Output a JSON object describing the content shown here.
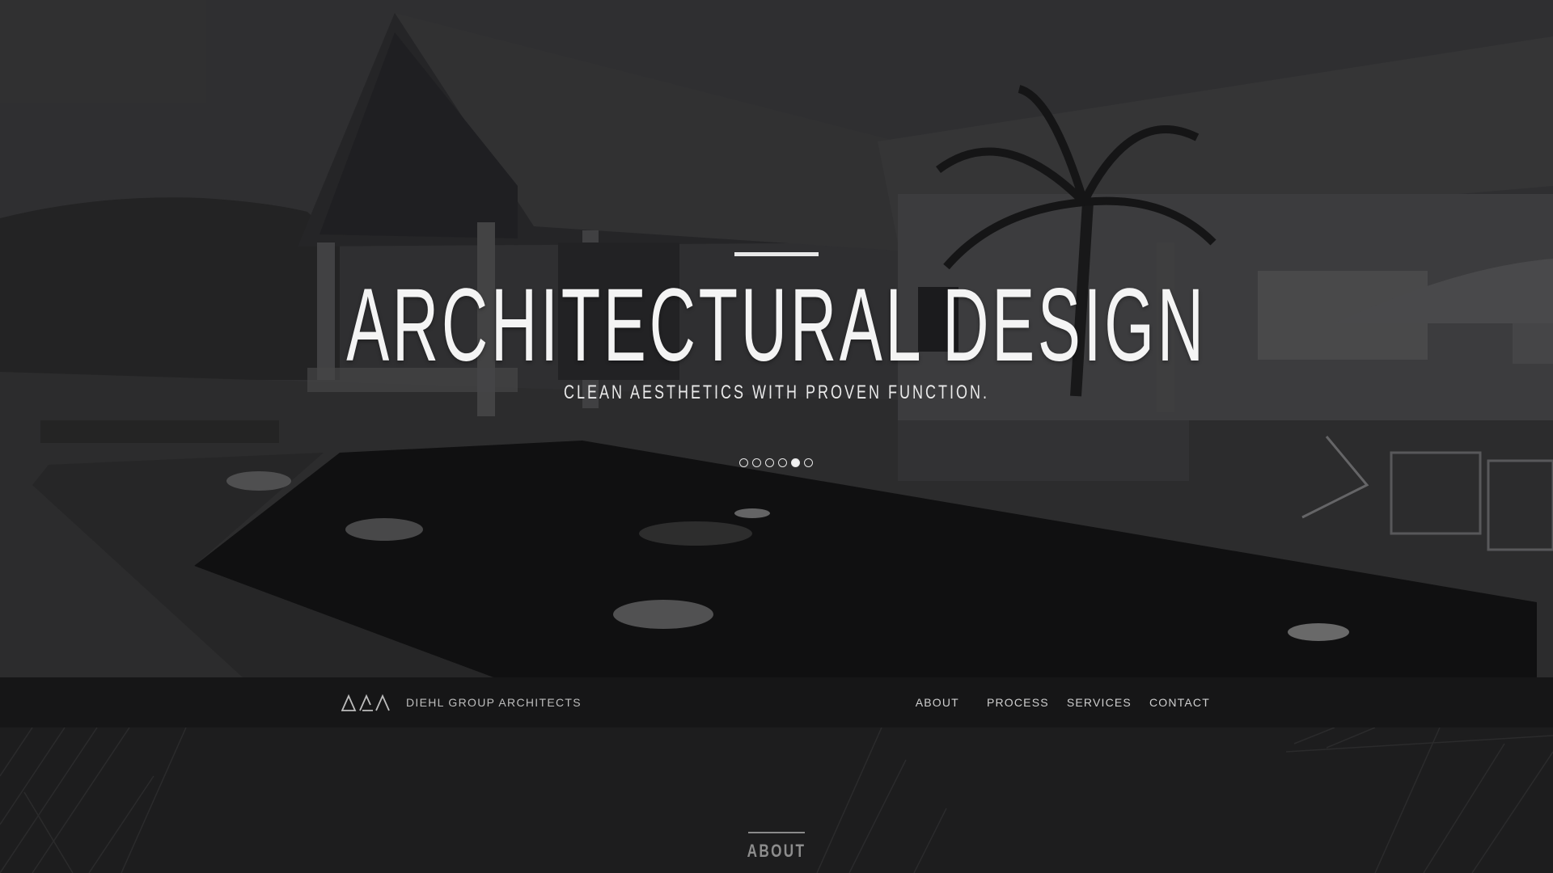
{
  "hero": {
    "title": "ARCHITECTURAL DESIGN",
    "subtitle": "CLEAN AESTHETICS WITH PROVEN FUNCTION.",
    "slides_count": 6,
    "active_slide": 5
  },
  "navbar": {
    "brand_name": "DIEHL GROUP ARCHITECTS",
    "links": [
      "ABOUT",
      "PROCESS",
      "SERVICES",
      "CONTACT"
    ]
  },
  "about": {
    "heading": "ABOUT"
  },
  "colors": {
    "background": "#1c1c1d",
    "hero_text": "#f4f4f4",
    "nav_text": "#cfcfcf",
    "section_heading": "#8d8d8d"
  }
}
